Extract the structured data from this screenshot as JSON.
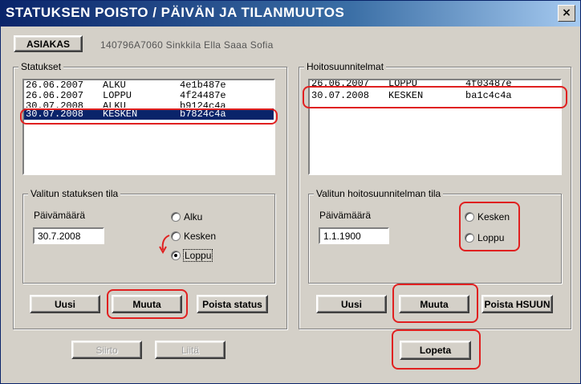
{
  "window": {
    "title": "STATUKSEN POISTO / PÄIVÄN JA TILANMUUTOS",
    "close_glyph": "×"
  },
  "customer": {
    "button_label": "ASIAKAS",
    "info_text": "140796A7060 Sinkkila Ella Saaa Sofia"
  },
  "statuses": {
    "group_label": "Statukset",
    "rows": [
      {
        "date": "26.06.2007",
        "state": "ALKU",
        "code": "4e1b487e",
        "selected": false
      },
      {
        "date": "26.06.2007",
        "state": "LOPPU",
        "code": "4f24487e",
        "selected": false
      },
      {
        "date": "30.07.2008",
        "state": "ALKU",
        "code": "b9124c4a",
        "selected": false
      },
      {
        "date": "30.07.2008",
        "state": "KESKEN",
        "code": "b7824c4a",
        "selected": true
      }
    ],
    "state_group_label": "Valitun statuksen tila",
    "date_label": "Päivämäärä",
    "date_value": "30.7.2008",
    "options": [
      "Alku",
      "Kesken",
      "Loppu"
    ],
    "selected_option": "Loppu",
    "new_button": "Uusi",
    "change_button": "Muuta",
    "delete_button": "Poista status"
  },
  "care_plans": {
    "group_label": "Hoitosuunnitelmat",
    "rows": [
      {
        "date": "26.06.2007",
        "state": "LOPPU",
        "code": "4f03487e",
        "selected": false
      },
      {
        "date": "30.07.2008",
        "state": "KESKEN",
        "code": "ba1c4c4a",
        "selected": false
      }
    ],
    "state_group_label": "Valitun hoitosuunnitelman tila",
    "date_label": "Päivämäärä",
    "date_value": "1.1.1900",
    "options": [
      "Kesken",
      "Loppu"
    ],
    "new_button": "Uusi",
    "change_button": "Muuta",
    "delete_button": "Poista HSUUN"
  },
  "footer": {
    "transfer_button": "Siirto",
    "attach_button": "Liitä",
    "quit_button": "Lopeta"
  },
  "colors": {
    "highlight": "#e02020",
    "selection": "#0a246a",
    "face": "#d4d0c8"
  }
}
